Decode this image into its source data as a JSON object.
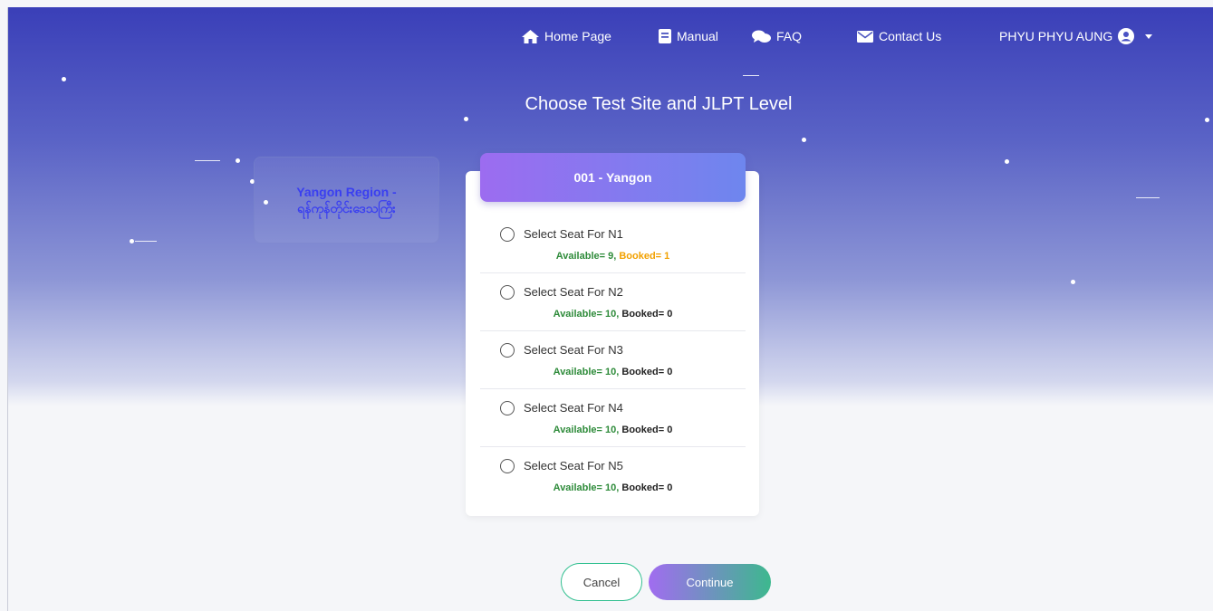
{
  "nav": {
    "home": "Home Page",
    "manual": "Manual",
    "faq": "FAQ",
    "contact": "Contact Us",
    "user": "PHYU PHYU AUNG"
  },
  "page_title": "Choose Test Site and JLPT Level",
  "region": {
    "line1": "Yangon Region -",
    "line2": "ရန်ကုန်တိုင်းဒေသကြီး"
  },
  "site": {
    "name": "001 - Yangon",
    "options": [
      {
        "label": "Select Seat For N1",
        "available": "Available= 9,",
        "booked": "Booked= 1"
      },
      {
        "label": "Select Seat For N2",
        "available": "Available= 10,",
        "booked": "Booked= 0"
      },
      {
        "label": "Select Seat For N3",
        "available": "Available= 10,",
        "booked": "Booked= 0"
      },
      {
        "label": "Select Seat For N4",
        "available": "Available= 10,",
        "booked": "Booked= 0"
      },
      {
        "label": "Select Seat For N5",
        "available": "Available= 10,",
        "booked": "Booked= 0"
      }
    ]
  },
  "buttons": {
    "cancel": "Cancel",
    "continue": "Continue"
  },
  "colors": {
    "available": "#2e8b3a",
    "booked_nonzero": "#f2a100",
    "region_text": "#3a3ff0",
    "header_gradient_start": "#9c6cf0",
    "header_gradient_end": "#6e86ee"
  },
  "icons": [
    "home-icon",
    "book-icon",
    "comments-icon",
    "envelope-icon",
    "user-circle-icon",
    "caret-down-icon"
  ]
}
